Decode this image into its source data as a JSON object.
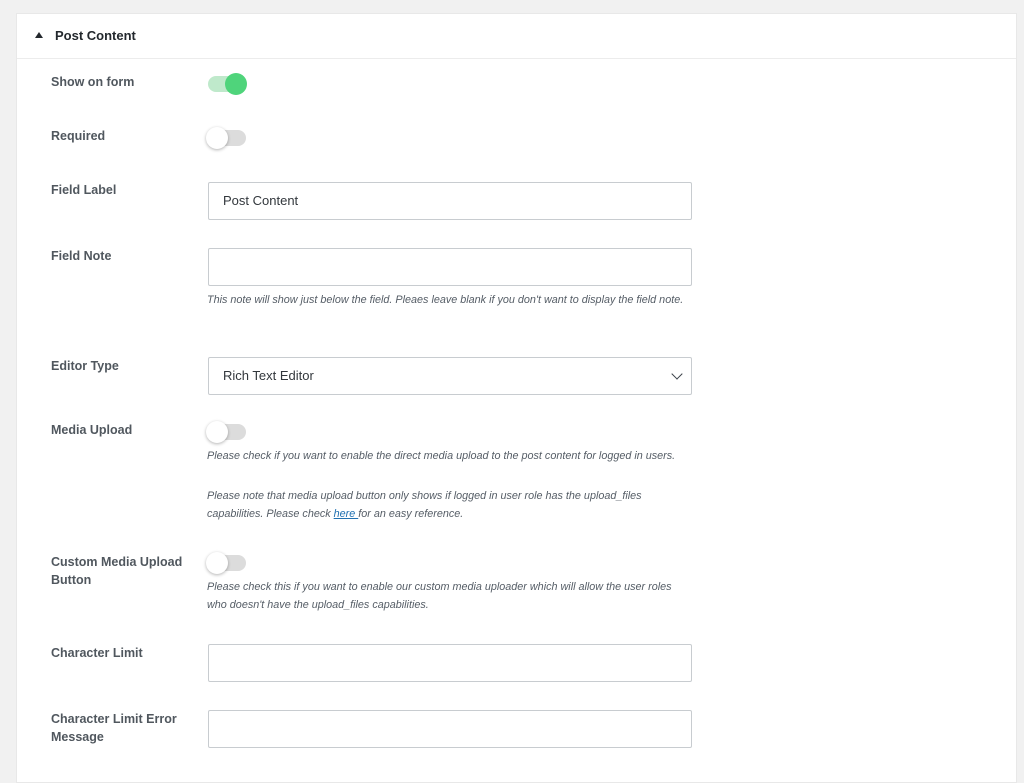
{
  "section": {
    "title": "Post Content"
  },
  "fields": {
    "show_on_form": {
      "label": "Show on form",
      "enabled": true
    },
    "required": {
      "label": "Required",
      "enabled": false
    },
    "field_label": {
      "label": "Field Label",
      "value": "Post Content"
    },
    "field_note": {
      "label": "Field Note",
      "value": "",
      "help": "This note will show just below the field. Pleaes leave blank if you don't want to display the field note."
    },
    "editor_type": {
      "label": "Editor Type",
      "selected": "Rich Text Editor"
    },
    "media_upload": {
      "label": "Media Upload",
      "enabled": false,
      "help": "Please check if you want to enable the direct media upload to the post content for logged in users.",
      "help2_before": "Please note that media upload button only shows if logged in user role has the upload_files capabilities. Please check ",
      "help2_link": "here ",
      "help2_after": "for an easy reference."
    },
    "custom_media_upload": {
      "label_line1": "Custom Media Upload",
      "label_line2": "Button",
      "enabled": false,
      "help": "Please check this if you want to enable our custom media uploader which will allow the user roles who doesn't have the upload_files capabilities."
    },
    "character_limit": {
      "label": "Character Limit",
      "value": ""
    },
    "character_limit_error": {
      "label_line1": "Character Limit Error",
      "label_line2": "Message",
      "value": ""
    }
  },
  "icons": {
    "section_toggle": "caret-up-icon",
    "select_arrow": "chevron-down-icon"
  },
  "colors": {
    "toggle_on": "#4fd47b",
    "toggle_on_track": "#bfe9cb",
    "link": "#2271b1"
  }
}
